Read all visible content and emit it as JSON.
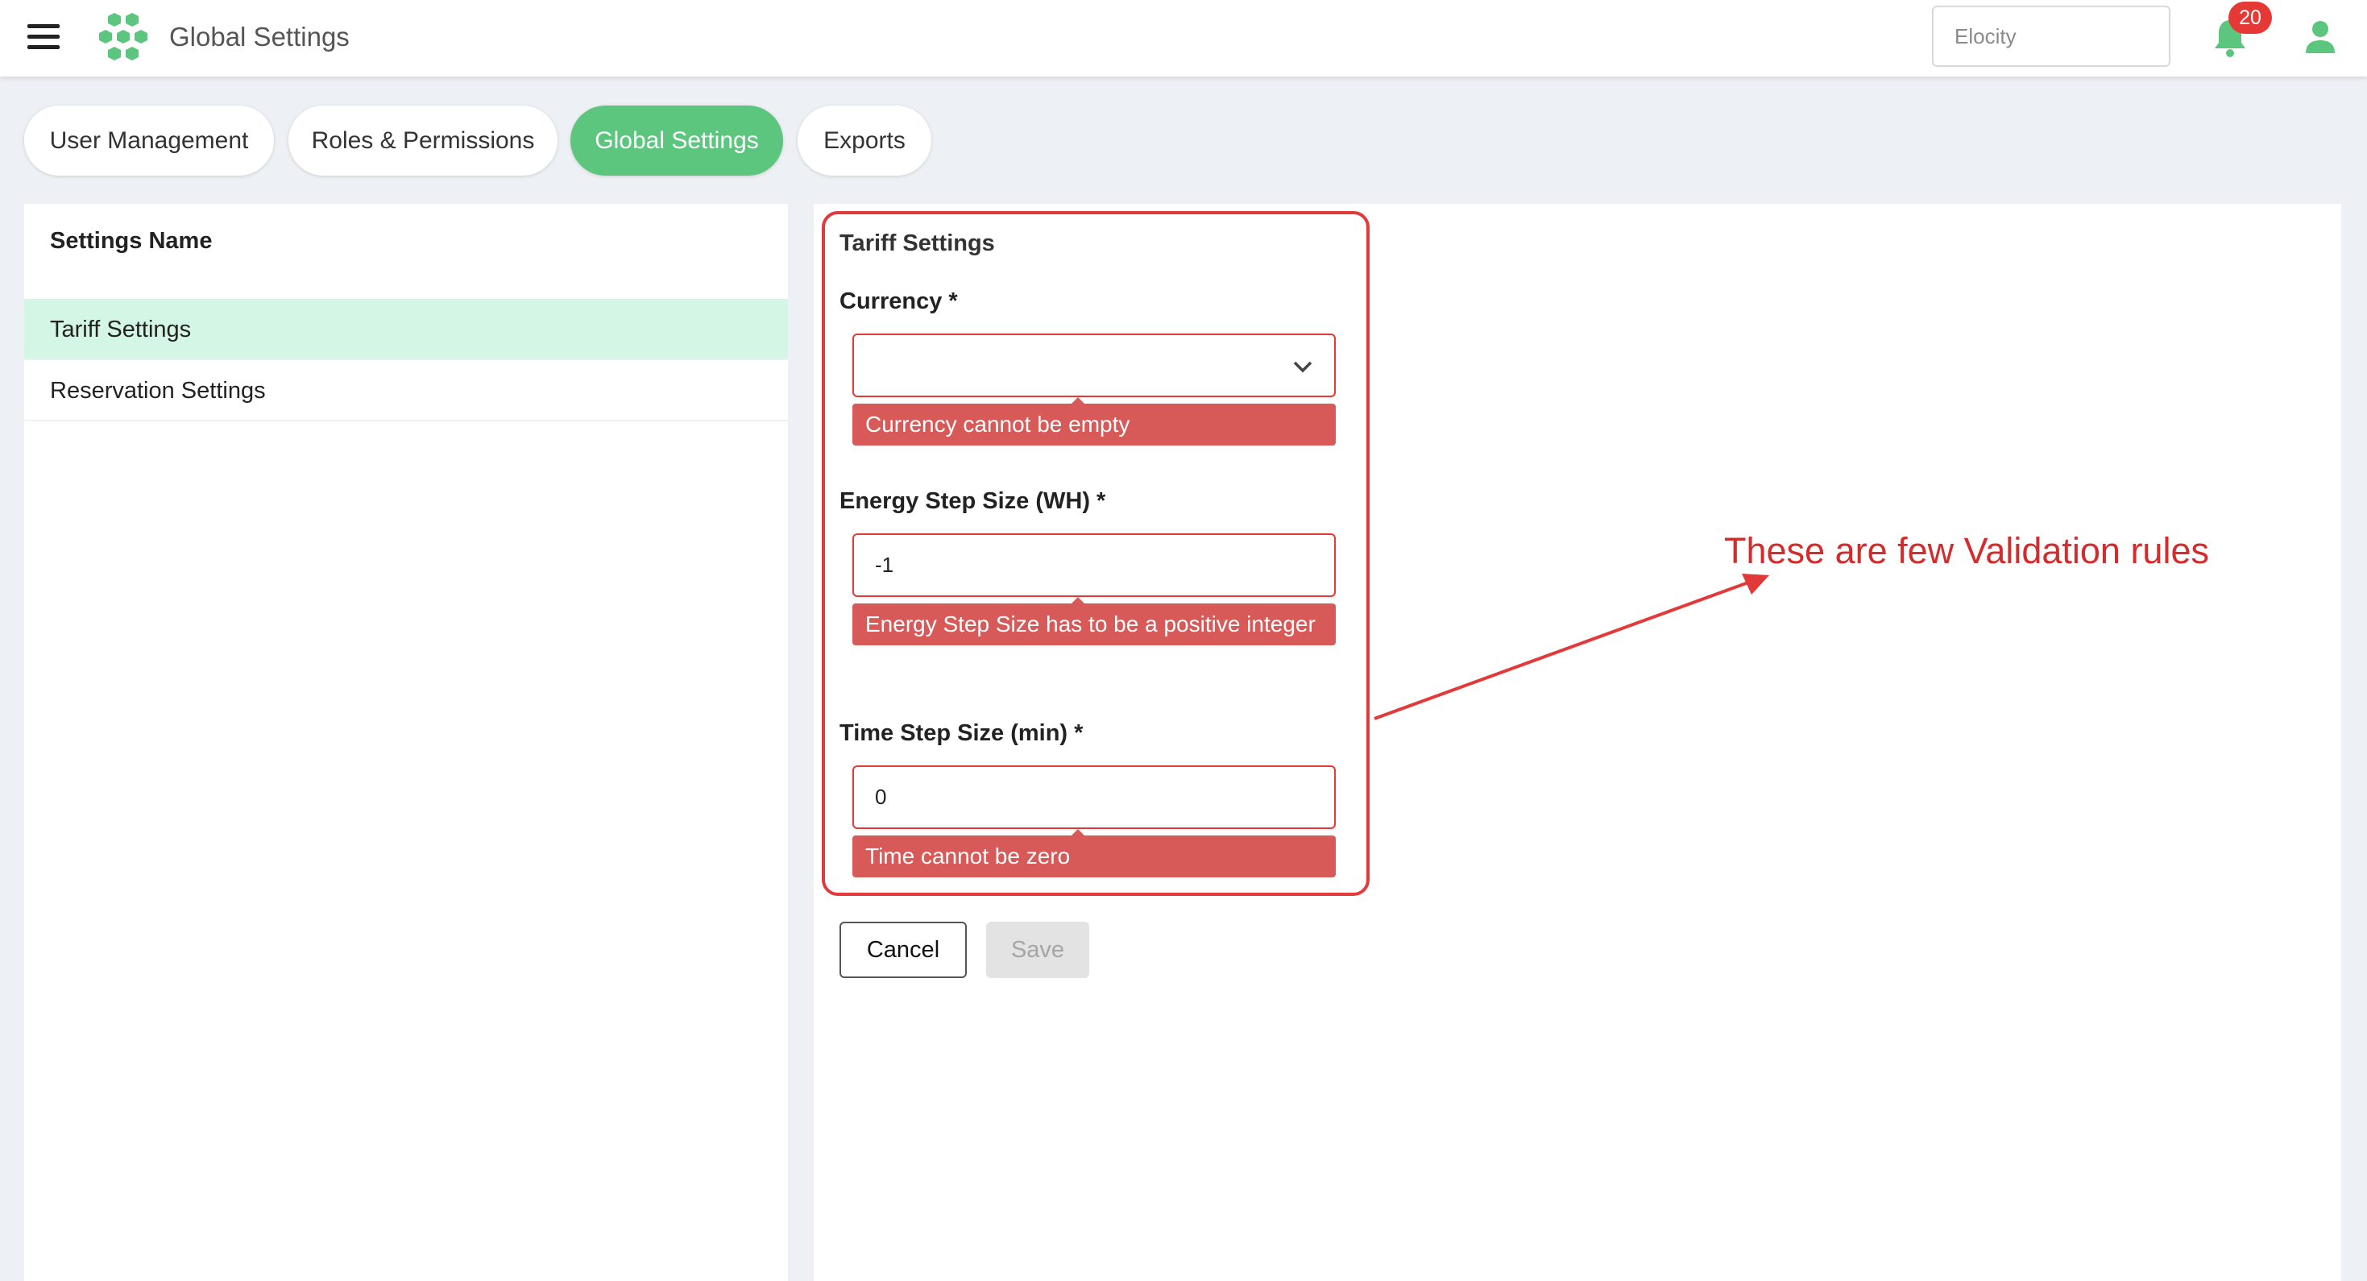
{
  "header": {
    "menu_icon": "hamburger-menu-icon",
    "logo_icon": "hexagon-cluster-logo",
    "title": "Global Settings",
    "org_placeholder": "Elocity",
    "notification_count": "20",
    "notification_icon": "bell-icon",
    "user_icon": "user-icon"
  },
  "tabs": [
    {
      "label": "User Management",
      "active": false
    },
    {
      "label": "Roles & Permissions",
      "active": false
    },
    {
      "label": "Global Settings",
      "active": true
    },
    {
      "label": "Exports",
      "active": false
    }
  ],
  "settings_list": {
    "header": "Settings Name",
    "items": [
      {
        "label": "Tariff Settings",
        "selected": true
      },
      {
        "label": "Reservation Settings",
        "selected": false
      }
    ]
  },
  "form": {
    "title": "Tariff Settings",
    "currency": {
      "label": "Currency *",
      "value": "",
      "error": "Currency cannot be empty"
    },
    "energy_step": {
      "label": "Energy Step Size (WH) *",
      "value": "-1",
      "error": "Energy Step Size has to be a positive integer"
    },
    "time_step": {
      "label": "Time Step Size (min) *",
      "value": "0",
      "error": "Time cannot be zero"
    },
    "cancel_label": "Cancel",
    "save_label": "Save"
  },
  "annotation": {
    "text": "These are few Validation rules"
  },
  "colors": {
    "accent_green": "#5cc67e",
    "selected_row": "#d4f6e4",
    "error_red": "#e53935",
    "error_bg": "#d85a58",
    "annotation_red": "#d32c2c"
  }
}
